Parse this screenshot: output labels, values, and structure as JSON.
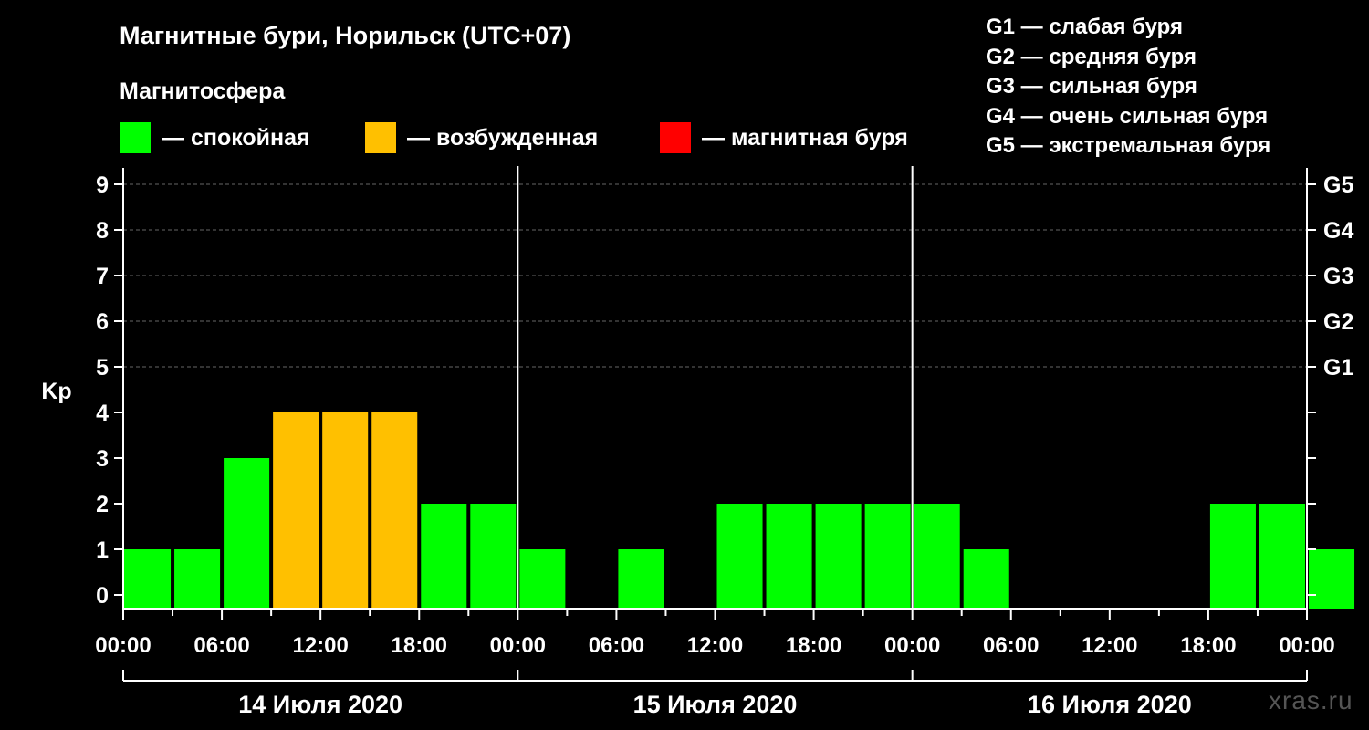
{
  "chart_data": {
    "type": "bar",
    "title": "Магнитные бури, Норильск (UTC+07)",
    "subtitle": "Магнитосфера",
    "ylabel": "Kp",
    "ylim": [
      0,
      9
    ],
    "y_ticks": [
      "0",
      "1",
      "2",
      "3",
      "4",
      "5",
      "6",
      "7",
      "8",
      "9"
    ],
    "right_ticks": [
      {
        "kp": 5,
        "label": "G1"
      },
      {
        "kp": 6,
        "label": "G2"
      },
      {
        "kp": 7,
        "label": "G3"
      },
      {
        "kp": 8,
        "label": "G4"
      },
      {
        "kp": 9,
        "label": "G5"
      }
    ],
    "x_tick_labels": [
      "00:00",
      "06:00",
      "12:00",
      "18:00",
      "00:00",
      "06:00",
      "12:00",
      "18:00",
      "00:00",
      "06:00",
      "12:00",
      "18:00",
      "00:00"
    ],
    "days": [
      "14 Июля 2020",
      "15 Июля 2020",
      "16 Июля 2020"
    ],
    "interval_hours": 3,
    "values": [
      1,
      1,
      3,
      4,
      4,
      4,
      2,
      2,
      1,
      null,
      1,
      null,
      2,
      2,
      2,
      2,
      2,
      1,
      null,
      null,
      null,
      null,
      2,
      2,
      1
    ],
    "levels": [
      "quiet",
      "quiet",
      "quiet",
      "disturbed",
      "disturbed",
      "disturbed",
      "quiet",
      "quiet",
      "quiet",
      null,
      "quiet",
      null,
      "quiet",
      "quiet",
      "quiet",
      "quiet",
      "quiet",
      "quiet",
      null,
      null,
      null,
      null,
      "quiet",
      "quiet",
      "quiet"
    ],
    "colors": {
      "quiet": "#00ff00",
      "disturbed": "#ffc000",
      "storm": "#ff0000",
      "grid": "#666666"
    },
    "grid": true
  },
  "legend": {
    "quiet": "— спокойная",
    "disturbed": "— возбужденная",
    "storm": "— магнитная буря"
  },
  "g_scale": [
    "G1 — слабая буря",
    "G2 — средняя буря",
    "G3 — сильная буря",
    "G4 — очень сильная буря",
    "G5 — экстремальная буря"
  ],
  "watermark": "xras.ru"
}
